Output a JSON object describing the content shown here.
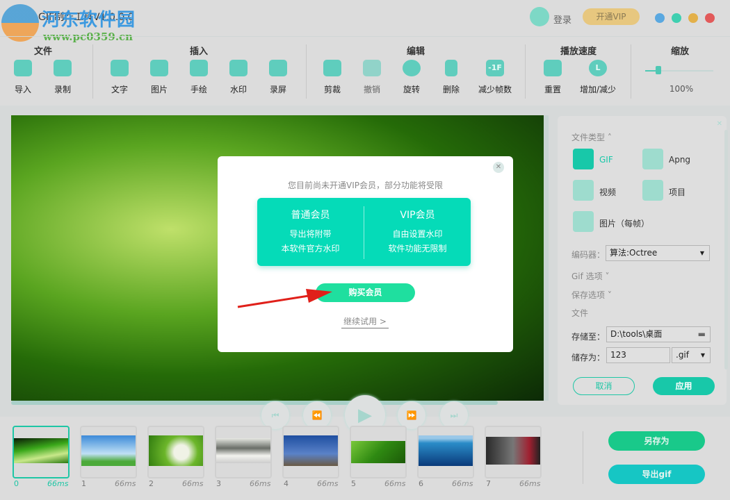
{
  "window": {
    "title": "GIF制作工具V1.0.0.0",
    "watermark_name": "河东软件园",
    "watermark_url": "www.pc0359.cn",
    "login": "登录",
    "vip_button": "开通VIP"
  },
  "toolbar": {
    "groups": [
      "文件",
      "插入",
      "编辑",
      "播放速度",
      "缩放"
    ],
    "tools": [
      {
        "label": "导入",
        "icon": "folder-icon"
      },
      {
        "label": "录制",
        "icon": "camera-icon"
      },
      {
        "label": "文字",
        "icon": "text-icon"
      },
      {
        "label": "图片",
        "icon": "image-icon"
      },
      {
        "label": "手绘",
        "icon": "pen-icon"
      },
      {
        "label": "水印",
        "icon": "stamp-icon"
      },
      {
        "label": "录屏",
        "icon": "screen-record-icon"
      },
      {
        "label": "剪裁",
        "icon": "crop-icon"
      },
      {
        "label": "撤销",
        "icon": "undo-icon"
      },
      {
        "label": "旋转",
        "icon": "rotate-icon"
      },
      {
        "label": "删除",
        "icon": "trash-icon"
      },
      {
        "label": "减少帧数",
        "icon": "reduce-frames-icon",
        "glyph": "-1F"
      },
      {
        "label": "重置",
        "icon": "reset-icon"
      },
      {
        "label": "增加/减少",
        "icon": "speed-icon",
        "glyph": "L"
      }
    ],
    "zoom_value": "100%",
    "zoom_fraction": 0.15
  },
  "dialog": {
    "message": "您目前尚未开通VIP会员，部分功能将受限",
    "normal_title": "普通会员",
    "normal_lines": [
      "导出将附带",
      "本软件官方水印"
    ],
    "vip_title": "VIP会员",
    "vip_lines": [
      "自由设置水印",
      "软件功能无限制"
    ],
    "buy": "购买会员",
    "trial": "继续试用 >"
  },
  "panel": {
    "file_type": "文件类型",
    "types": [
      "GIF",
      "Apng",
      "视频",
      "项目",
      "图片（每帧）"
    ],
    "encoder_label": "编码器：",
    "encoder_value": "算法:Octree",
    "gif_options": "Gif 选项",
    "save_options": "保存选项",
    "file": "文件",
    "save_to_label": "存储至：",
    "save_to_value": "D:\\tools\\桌面",
    "save_as_label": "储存为：",
    "save_as_value": "123",
    "ext": ".gif",
    "cancel": "取消",
    "apply": "应用"
  },
  "frames": [
    {
      "n": "0",
      "ms": "66ms"
    },
    {
      "n": "1",
      "ms": "66ms"
    },
    {
      "n": "2",
      "ms": "66ms"
    },
    {
      "n": "3",
      "ms": "66ms"
    },
    {
      "n": "4",
      "ms": "66ms"
    },
    {
      "n": "5",
      "ms": "66ms"
    },
    {
      "n": "6",
      "ms": "66ms"
    },
    {
      "n": "7",
      "ms": "66ms"
    }
  ],
  "actions": {
    "save_as": "另存为",
    "export": "导出gif"
  },
  "colors": {
    "accent": "#18c8a9",
    "vip": "#e7c77f",
    "card": "#05dbb8"
  }
}
